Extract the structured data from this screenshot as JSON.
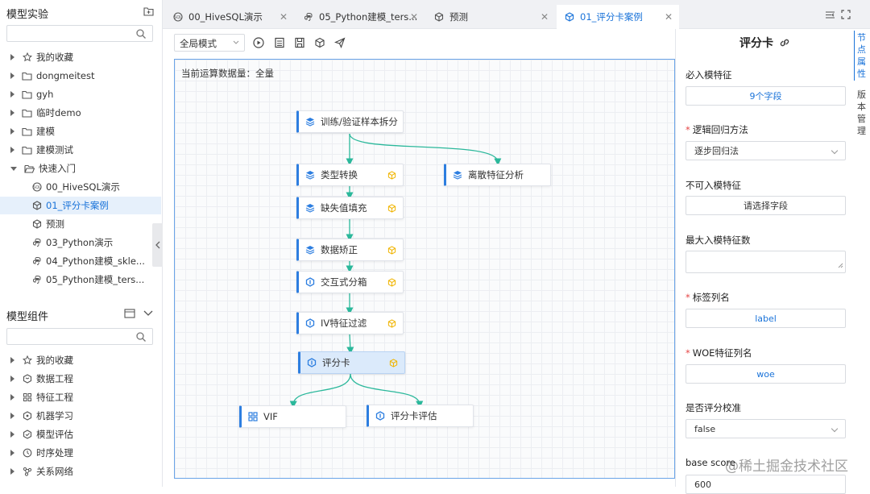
{
  "left": {
    "experiments_title": "模型实验",
    "tree": [
      {
        "label": "我的收藏",
        "icon": "star-icon",
        "caret": "closed"
      },
      {
        "label": "dongmeitest",
        "icon": "folder-icon",
        "caret": "closed"
      },
      {
        "label": "gyh",
        "icon": "folder-icon",
        "caret": "closed"
      },
      {
        "label": "临时demo",
        "icon": "folder-icon",
        "caret": "closed"
      },
      {
        "label": "建模",
        "icon": "folder-icon",
        "caret": "closed"
      },
      {
        "label": "建模测试",
        "icon": "folder-icon",
        "caret": "closed"
      },
      {
        "label": "快速入门",
        "icon": "folder-open-icon",
        "caret": "open"
      },
      {
        "label": "00_HiveSQL演示",
        "icon": "sql-icon",
        "caret": "none",
        "indent": 1
      },
      {
        "label": "01_评分卡案例",
        "icon": "cube-icon",
        "caret": "none",
        "indent": 1,
        "selected": true
      },
      {
        "label": "预测",
        "icon": "cube-icon",
        "caret": "none",
        "indent": 1
      },
      {
        "label": "03_Python演示",
        "icon": "python-icon",
        "caret": "none",
        "indent": 1
      },
      {
        "label": "04_Python建模_skle...",
        "icon": "python-icon",
        "caret": "none",
        "indent": 1
      },
      {
        "label": "05_Python建模_ters...",
        "icon": "python-icon",
        "caret": "none",
        "indent": 1
      }
    ],
    "components_title": "模型组件",
    "components": [
      {
        "label": "我的收藏",
        "icon": "star-icon"
      },
      {
        "label": "数据工程",
        "icon": "data-engineering-icon"
      },
      {
        "label": "特征工程",
        "icon": "feature-engineering-icon"
      },
      {
        "label": "机器学习",
        "icon": "machine-learning-icon"
      },
      {
        "label": "模型评估",
        "icon": "model-evaluation-icon"
      },
      {
        "label": "时序处理",
        "icon": "time-series-icon"
      },
      {
        "label": "关系网络",
        "icon": "network-icon"
      }
    ]
  },
  "tabs": [
    {
      "label": "00_HiveSQL演示",
      "icon": "sql-icon",
      "close": "✕"
    },
    {
      "label": "05_Python建模_ters...",
      "icon": "python-icon",
      "close": "✕"
    },
    {
      "label": "预测",
      "icon": "cube-icon",
      "close": "✕"
    },
    {
      "label": "01_评分卡案例",
      "icon": "cube-icon",
      "close": "✕",
      "active": true
    }
  ],
  "toolbar": {
    "mode": "全局模式"
  },
  "canvas": {
    "data_volume": "当前运算数据量：全量",
    "nodes": [
      {
        "label": "训练/验证样本拆分",
        "icon": "layers-icon",
        "warn": false
      },
      {
        "label": "类型转换",
        "icon": "layers-icon",
        "warn": true
      },
      {
        "label": "离散特征分析",
        "icon": "layers-icon",
        "warn": false
      },
      {
        "label": "缺失值填充",
        "icon": "layers-icon",
        "warn": true
      },
      {
        "label": "数据矫正",
        "icon": "layers-icon",
        "warn": true
      },
      {
        "label": "交互式分箱",
        "icon": "hexagon-icon",
        "warn": true
      },
      {
        "label": "IV特征过滤",
        "icon": "hexagon-icon",
        "warn": true
      },
      {
        "label": "评分卡",
        "icon": "hexagon-icon",
        "warn": true,
        "selected": true
      },
      {
        "label": "VIF",
        "icon": "grid-icon",
        "warn": false
      },
      {
        "label": "评分卡评估",
        "icon": "hexagon-icon",
        "warn": false
      }
    ]
  },
  "panel": {
    "title": "评分卡",
    "fields": [
      {
        "label": "必入模特征",
        "required": false,
        "value": "9个字段",
        "style": "blue"
      },
      {
        "label": "逻辑回归方法",
        "required": true,
        "value": "逐步回归法",
        "style": "select"
      },
      {
        "label": "不可入模特征",
        "required": false,
        "value": "请选择字段",
        "style": "plain"
      },
      {
        "label": "最大入模特征数",
        "required": false,
        "value": "",
        "style": "textarea"
      },
      {
        "label": "标签列名",
        "required": true,
        "value": "label",
        "style": "blue"
      },
      {
        "label": "WOE特征列名",
        "required": true,
        "value": "woe",
        "style": "blue"
      },
      {
        "label": "是否评分校准",
        "required": false,
        "value": "false",
        "style": "select"
      },
      {
        "label": "base score",
        "required": false,
        "value": "600",
        "style": "plain-left"
      }
    ]
  },
  "side_tabs": {
    "node_props": "节点属性",
    "version": "版本管理"
  },
  "watermark": "@稀土掘金技术社区",
  "colors": {
    "accent": "#2d7ee0",
    "edge": "#2bb89b",
    "warn": "#f0b400"
  }
}
